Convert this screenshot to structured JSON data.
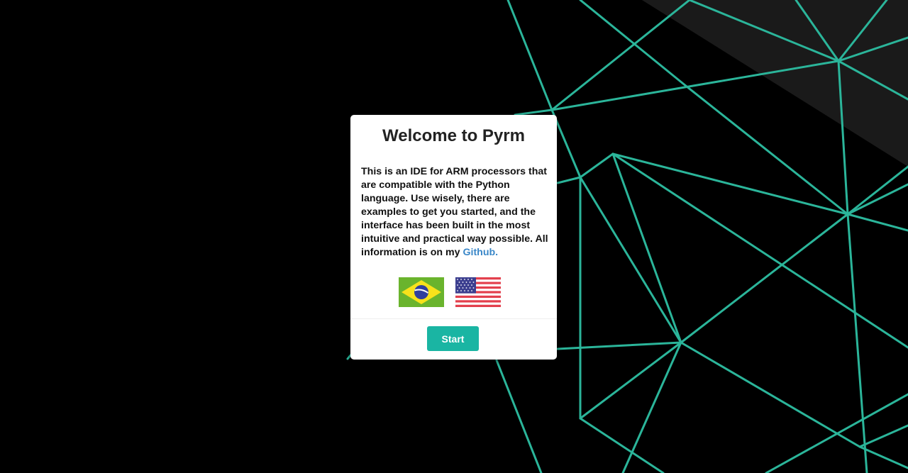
{
  "colors": {
    "background": "#000000",
    "line": "#2bb59a",
    "accent": "#1ab5a3",
    "link": "#3a87c8",
    "corner_shade": "#1a1a1a"
  },
  "modal": {
    "title": "Welcome to Pyrm",
    "body_text": "This is an IDE for ARM processors that are compatible with the Python language. Use wisely, there are examples to get you started, and the interface has been built in the most intuitive and practical way possible. All information is on my ",
    "link_text": "Github.",
    "flags": [
      {
        "icon": "brazil-flag-icon"
      },
      {
        "icon": "usa-flag-icon"
      }
    ],
    "start_label": "Start"
  }
}
